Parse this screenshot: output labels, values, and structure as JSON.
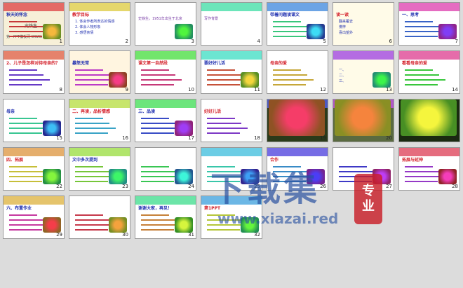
{
  "slides": [
    {
      "n": "1",
      "title": "秋天的怀念",
      "author": "史铁生",
      "footer": "第一PPT模板网 WWW.1PPT.COM",
      "color": "#f7f0d8"
    },
    {
      "n": "2",
      "title": "教学目标",
      "items": [
        "1. 体会作者所表达的情感",
        "2. 体会人物形象",
        "3. 感悟亲情"
      ],
      "color": "#ffffff"
    },
    {
      "n": "3",
      "text": "史铁生，1951年出生于北京",
      "color": "#ffffff"
    },
    {
      "n": "4",
      "text": "写作背景",
      "color": "#ffffff"
    },
    {
      "n": "5",
      "title": "带着问题读课文",
      "color": "#ffffff"
    },
    {
      "n": "6",
      "title": "读一读",
      "items": [
        "翻来覆去",
        "憔悴",
        "喜出望外"
      ],
      "color": "#fffbe8"
    },
    {
      "n": "7",
      "title": "一、思考",
      "color": "#ffffff"
    },
    {
      "n": "8",
      "title": "2、儿子是怎样对待母亲的？",
      "color": "#ffffff"
    },
    {
      "n": "9",
      "title": "暴怒无常",
      "color": "#fff5e0"
    },
    {
      "n": "10",
      "title": "课文第一自然段",
      "color": "#ffffff"
    },
    {
      "n": "11",
      "title": "要好好儿活",
      "color": "#ffffff"
    },
    {
      "n": "12",
      "title": "母亲的爱",
      "color": "#ffffff"
    },
    {
      "n": "13",
      "items": [
        "一、",
        "二、",
        "三、"
      ],
      "color": "#fffbe8"
    },
    {
      "n": "14",
      "title": "看看母亲的爱",
      "color": "#ffffff"
    },
    {
      "n": "15",
      "title": "母亲",
      "color": "#ffffff"
    },
    {
      "n": "16",
      "title": "二、再读，品析情感",
      "color": "#ffffff"
    },
    {
      "n": "17",
      "title": "三、品读",
      "color": "#ffffff"
    },
    {
      "n": "18",
      "title": "好好儿活",
      "color": "#ffffff"
    },
    {
      "n": "19",
      "color": "#2a3a1a"
    },
    {
      "n": "20",
      "color": "#5a6a40"
    },
    {
      "n": "21",
      "color": "#1a2a10"
    },
    {
      "n": "22",
      "title": "四、拓展",
      "color": "#ffffff"
    },
    {
      "n": "23",
      "title": "文中多次提到",
      "color": "#ffffff"
    },
    {
      "n": "24",
      "color": "#ffffff"
    },
    {
      "n": "25",
      "color": "#ffffff"
    },
    {
      "n": "26",
      "title": "合作",
      "color": "#ffffff"
    },
    {
      "n": "27",
      "color": "#ffffff"
    },
    {
      "n": "28",
      "title": "拓展与延伸",
      "color": "#ffffff"
    },
    {
      "n": "29",
      "title": "六、布置作业",
      "color": "#ffffff"
    },
    {
      "n": "30",
      "color": "#ffffff"
    },
    {
      "n": "31",
      "title": "谢谢大家，再见！",
      "color": "#ffffff"
    },
    {
      "n": "32",
      "title": "第1PPT",
      "color": "#ffffff"
    }
  ],
  "watermark": {
    "title": "下载集",
    "url": "www.xiazai.red",
    "seal_top": "专",
    "seal_bottom": "业"
  }
}
